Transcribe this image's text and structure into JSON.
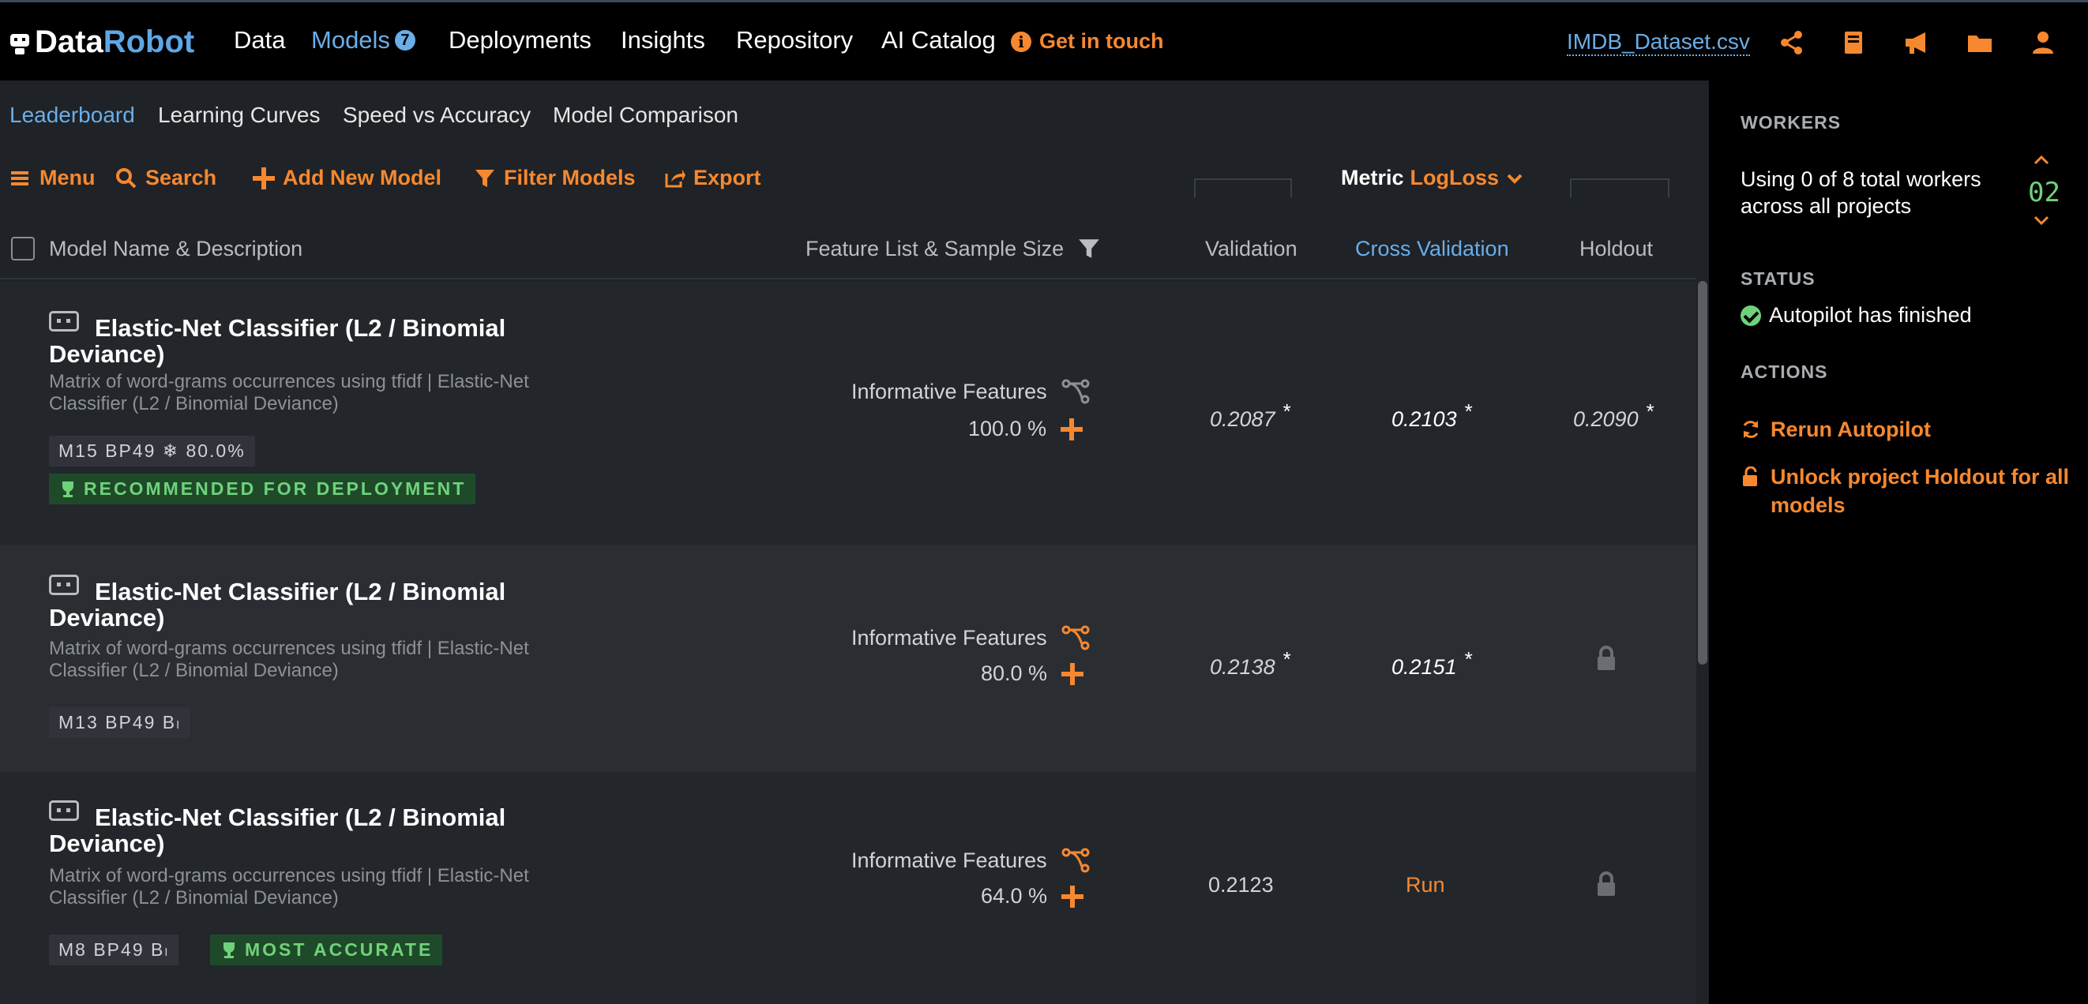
{
  "app": {
    "logo_part1": "Data",
    "logo_part2": "Robot"
  },
  "topnav": {
    "data": "Data",
    "models": "Models",
    "models_badge": "7",
    "deployments": "Deployments",
    "insights": "Insights",
    "repository": "Repository",
    "ai_catalog": "AI Catalog",
    "get_in_touch": "Get in touch",
    "dataset": "IMDB_Dataset.csv",
    "icons": [
      "share-icon",
      "book-icon",
      "megaphone-icon",
      "folder-icon",
      "user-icon"
    ]
  },
  "subtabs": [
    "Leaderboard",
    "Learning Curves",
    "Speed vs Accuracy",
    "Model Comparison"
  ],
  "toolbar": {
    "menu": "Menu",
    "search": "Search",
    "add_new_model": "Add New Model",
    "filter_models": "Filter Models",
    "export": "Export",
    "metric_label": "Metric",
    "metric_value": "LogLoss"
  },
  "table": {
    "headers": {
      "model": "Model Name & Description",
      "feature": "Feature List & Sample Size",
      "validation": "Validation",
      "cross_validation": "Cross Validation",
      "holdout": "Holdout"
    },
    "rows": [
      {
        "name": "Elastic-Net Classifier (L2 / Binomial Deviance)",
        "desc": "Matrix of word-grams occurrences using tfidf | Elastic-Net Classifier (L2 / Binomial Deviance)",
        "tag": "M15  BP49  ❄ 80.0%",
        "badge": "RECOMMENDED FOR DEPLOYMENT",
        "feature_list": "Informative Features",
        "sample_size": "100.0 %",
        "validation": "0.2087",
        "validation_star": "*",
        "cross_validation": "0.2103",
        "cv_star": "*",
        "holdout": "0.2090",
        "holdout_star": "*"
      },
      {
        "name": "Elastic-Net Classifier (L2 / Binomial Deviance)",
        "desc": "Matrix of word-grams occurrences using tfidf | Elastic-Net Classifier (L2 / Binomial Deviance)",
        "tag": "M13  BP49  Bₗ",
        "feature_list": "Informative Features",
        "sample_size": "80.0 %",
        "validation": "0.2138",
        "validation_star": "*",
        "cross_validation": "0.2151",
        "cv_star": "*"
      },
      {
        "name": "Elastic-Net Classifier (L2 / Binomial Deviance)",
        "desc": "Matrix of word-grams occurrences using tfidf | Elastic-Net Classifier (L2 / Binomial Deviance)",
        "tag": "M8  BP49  Bₗ",
        "badge": "MOST ACCURATE",
        "feature_list": "Informative Features",
        "sample_size": "64.0 %",
        "validation": "0.2123",
        "cross_validation": "Run"
      }
    ]
  },
  "sidebar": {
    "workers_label": "WORKERS",
    "workers_text": "Using 0 of 8 total workers across all projects",
    "workers_count": "02",
    "status_label": "STATUS",
    "status_text": "Autopilot has finished",
    "actions_label": "ACTIONS",
    "rerun": "Rerun Autopilot",
    "unlock": "Unlock project Holdout for all models"
  },
  "colors": {
    "accent": "#f7882f",
    "link": "#6aaee8",
    "success": "#6fd27a"
  }
}
